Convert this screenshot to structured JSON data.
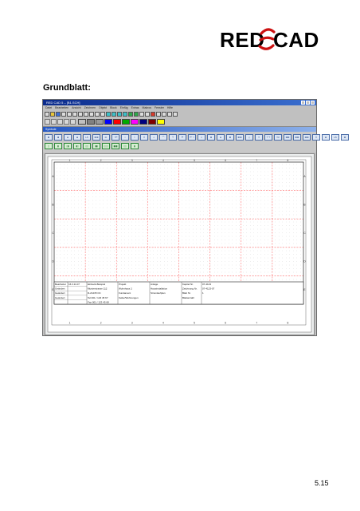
{
  "brand": {
    "left": "RED",
    "right": "CAD"
  },
  "heading": "Grundblatt:",
  "window": {
    "title": "RED CAD 5 – [B1.SCH]",
    "menu": [
      "Datei",
      "Bearbeiten",
      "Ansicht",
      "Zeichnen",
      "Objekt",
      "Block",
      "Einfüg",
      "Extras",
      "Makros",
      "Fenster",
      "Hilfe"
    ]
  },
  "palette": {
    "title": "Symbole",
    "row1": [
      "⊏",
      "⊐",
      "⊟",
      "⊞",
      "L5",
      "⊏⊐",
      "FI",
      "⊣⊢",
      "○",
      "⌇",
      "⌇⌇",
      "⊥",
      "⌒",
      "⊤",
      "⊢",
      "⊢⊣",
      "□",
      "⊠",
      "⊟",
      "⊏",
      "⊏⊐",
      "◇",
      "T",
      "⊤⊤",
      "TV",
      "⊐⊏",
      "⊏⊏",
      "⊐⊐",
      "⌇⌇",
      "⊞",
      "L5",
      "⊠"
    ],
    "row2": [
      "▯",
      "▮",
      "▯▮",
      "▮▯",
      "▯▯",
      "▮▮",
      "▯▯▯",
      "▮▮▮",
      "▯▯",
      "▮"
    ]
  },
  "titleblock": {
    "r1": [
      "Bearbeitet",
      "16.3.11.07",
      "Einbeck-Beispiel",
      "Projekt",
      "Anlage",
      "Kapitel Nr.",
      "07-4123"
    ],
    "r2": [
      "Geändert",
      "",
      "Musterstrasse 112",
      "Wohnhaus 2",
      "Hausinstallation",
      "Zeichnung Nr.",
      "07-4123-07"
    ],
    "r3": [
      "Geändert",
      "",
      "D-21235 Ort",
      "Fundament",
      "Stromlaufplan",
      "Blatt Nr.",
      "1"
    ],
    "r4": [
      "Geändert",
      "",
      "Tel 001 / 123 45 67",
      "Keller/Wohnungen",
      "",
      "Blattanzahl",
      ""
    ],
    "r5": [
      "",
      "",
      "Fax 001 / 123 45 68",
      "",
      "",
      "",
      ""
    ]
  },
  "grid": {
    "columns": [
      "1",
      "2",
      "3",
      "4",
      "5",
      "6",
      "7",
      "8"
    ],
    "rows": [
      "A",
      "B",
      "C",
      "D",
      "E"
    ]
  },
  "page_number": "5.15",
  "colors": {
    "swatches": [
      "#c0c0c0",
      "#808080",
      "#9a9a9a",
      "#0000ff",
      "#ff0000",
      "#00aa00",
      "#ff00ff",
      "#000080",
      "#800000",
      "#ffff00"
    ],
    "grid_red": "#ff6f6f",
    "titlebar": "#0b2b8c"
  }
}
